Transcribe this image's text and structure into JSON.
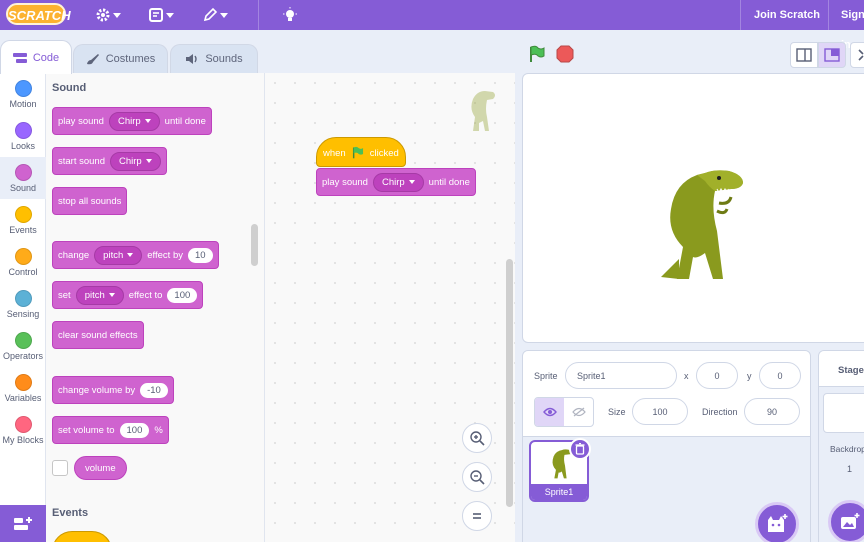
{
  "menubar": {
    "logo": "SCRATCH",
    "join": "Join Scratch",
    "signin": "Sign in",
    "icons": [
      "gear-icon",
      "file-icon",
      "edit-icon",
      "tutorials-icon"
    ]
  },
  "tabs": [
    {
      "label": "Code",
      "icon": "code-icon",
      "active": true
    },
    {
      "label": "Costumes",
      "icon": "brush-icon",
      "active": false
    },
    {
      "label": "Sounds",
      "icon": "speaker-icon",
      "active": false
    }
  ],
  "categories": [
    {
      "label": "Motion",
      "color": "#4c97ff"
    },
    {
      "label": "Looks",
      "color": "#9966ff"
    },
    {
      "label": "Sound",
      "color": "#cf63cf"
    },
    {
      "label": "Events",
      "color": "#ffbf00"
    },
    {
      "label": "Control",
      "color": "#ffab19"
    },
    {
      "label": "Sensing",
      "color": "#5cb1d6"
    },
    {
      "label": "Operators",
      "color": "#59c059"
    },
    {
      "label": "Variables",
      "color": "#ff8c1a"
    },
    {
      "label": "My Blocks",
      "color": "#ff6680"
    }
  ],
  "palette": {
    "sound_heading": "Sound",
    "events_heading": "Events",
    "blocks": {
      "play_until_done": {
        "pre": "play sound",
        "dd": "Chirp",
        "post": "until done"
      },
      "start_sound": {
        "pre": "start sound",
        "dd": "Chirp"
      },
      "stop_all": {
        "pre": "stop all sounds"
      },
      "change_effect": {
        "pre": "change",
        "dd": "pitch",
        "mid": "effect by",
        "num": "10"
      },
      "set_effect": {
        "pre": "set",
        "dd": "pitch",
        "mid": "effect to",
        "num": "100"
      },
      "clear_effects": {
        "pre": "clear sound effects"
      },
      "change_volume": {
        "pre": "change volume by",
        "num": "-10"
      },
      "set_volume": {
        "pre": "set volume to",
        "num": "100",
        "post": "%"
      },
      "volume_reporter": "volume"
    }
  },
  "script": {
    "hat_when": "when",
    "hat_clicked": "clicked",
    "play_pre": "play sound",
    "play_dd": "Chirp",
    "play_post": "until done"
  },
  "sprite_info": {
    "sprite_label": "Sprite",
    "sprite_name": "Sprite1",
    "x_label": "x",
    "x_value": "0",
    "y_label": "y",
    "y_value": "0",
    "show_label": "Show",
    "size_label": "Size",
    "size_value": "100",
    "direction_label": "Direction",
    "direction_value": "90"
  },
  "sprite_list": [
    {
      "name": "Sprite1"
    }
  ],
  "stage_pane": {
    "title": "Stage",
    "backdrops_label": "Backdrops",
    "backdrops_count": "1"
  },
  "colors": {
    "brand": "#855cd6",
    "sound": "#cf63cf",
    "events": "#ffbf00",
    "dino": "#8a9a1e"
  }
}
